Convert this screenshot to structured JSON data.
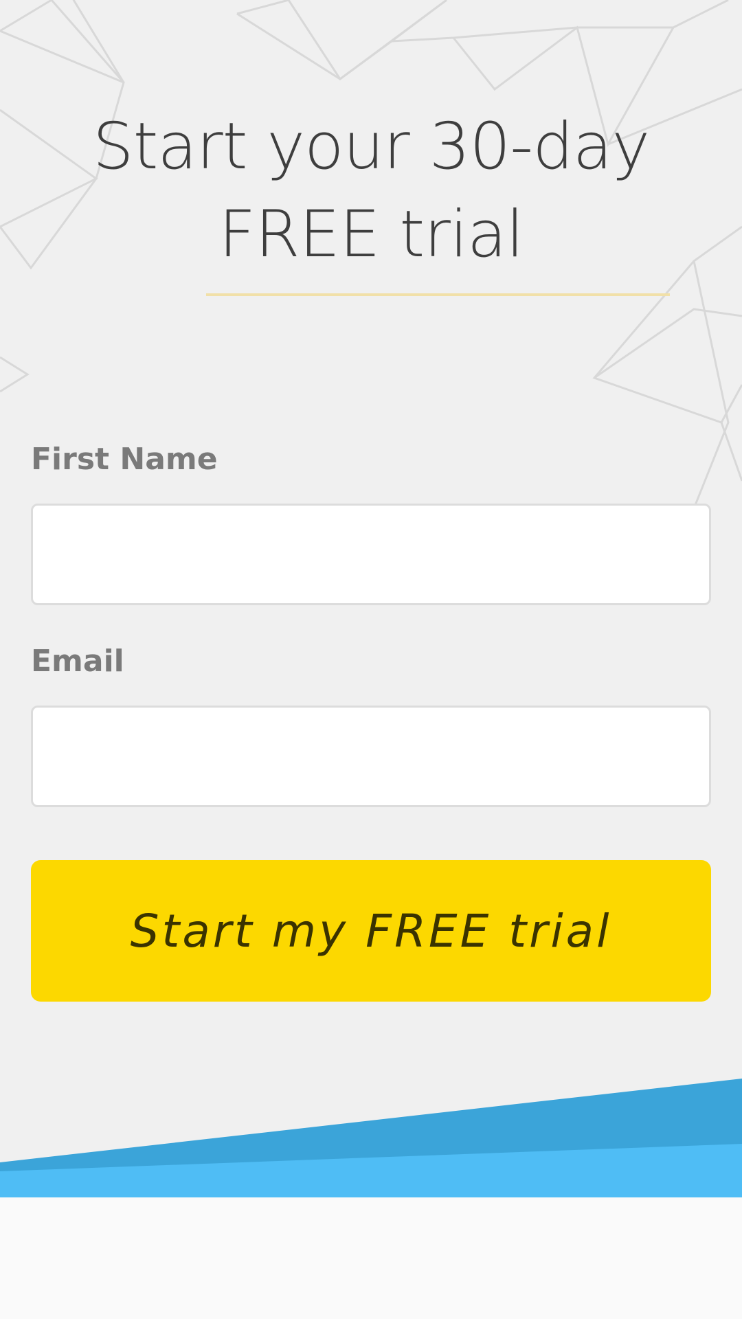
{
  "hero": {
    "title": "Start your 30-day FREE trial"
  },
  "form": {
    "first_name_label": "First Name",
    "first_name_value": "",
    "email_label": "Email",
    "email_value": "",
    "submit_label": "Start my FREE trial"
  },
  "colors": {
    "background": "#f0f0f0",
    "accent_underline": "#f1e0a8",
    "button": "#fcd800",
    "wave_dark": "#3ba4d9",
    "wave_light": "#4fbdf5"
  }
}
